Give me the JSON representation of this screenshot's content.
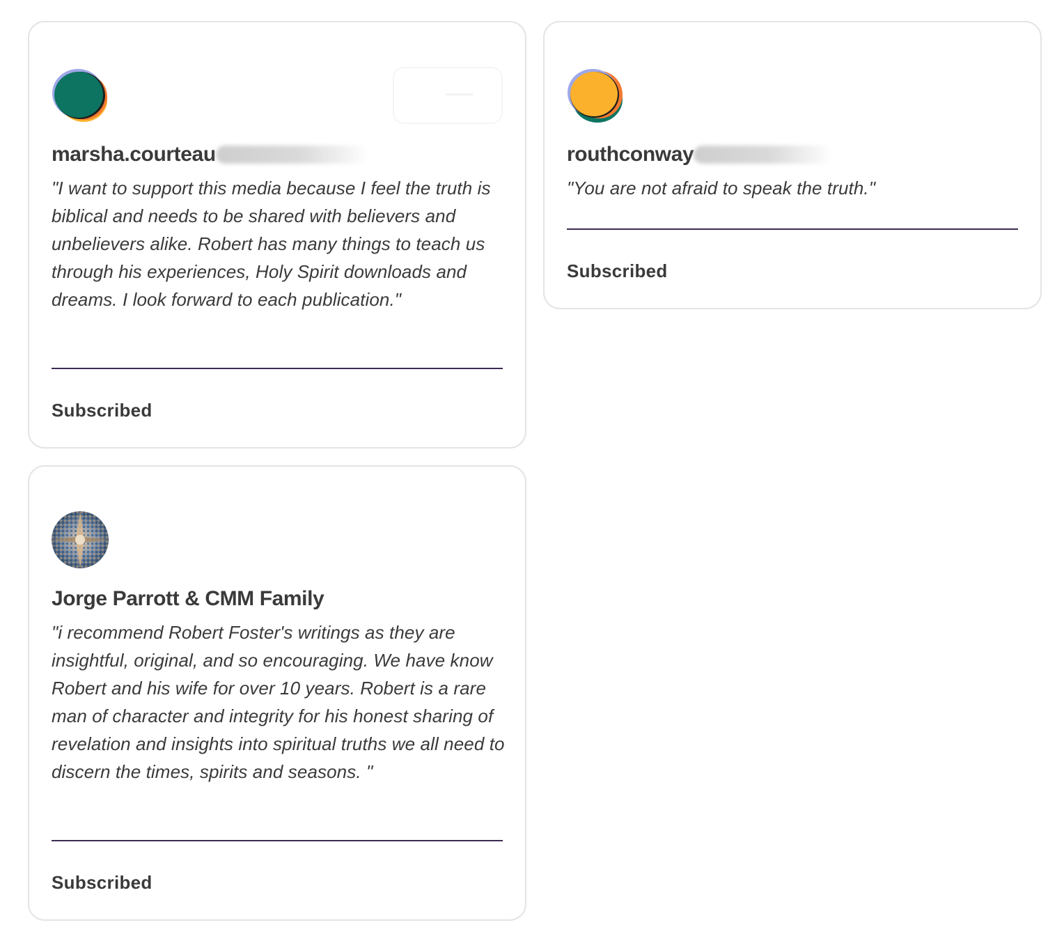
{
  "testimonials": [
    {
      "name": "marsha.courteau",
      "name_suffix_redacted": true,
      "quote": "\"I want to support this media because I feel the truth is biblical and needs to be shared with believers and unbelievers alike. Robert has many things to teach us through his experiences, Holy Spirit downloads and dreams. I look forward to each publication.\"",
      "status": "Subscribed",
      "avatar_icon": "green-orange-blob-avatar",
      "avatar_colors": [
        "#0c7461",
        "#f4792e",
        "#fbb12c",
        "#9fa8e8"
      ]
    },
    {
      "name": "routhconway",
      "name_suffix_redacted": true,
      "quote": "\"You are not afraid to speak the truth.\"",
      "status": "Subscribed",
      "avatar_icon": "yellow-green-blob-avatar",
      "avatar_colors": [
        "#fbb12c",
        "#0c7461",
        "#f4792e",
        "#9fa8e8"
      ]
    },
    {
      "name": "Jorge Parrott & CMM Family",
      "name_suffix_redacted": false,
      "quote": "\"i recommend Robert Foster's writings as they are insightful, original, and so encouraging. We have know Robert and his wife for over 10 years. Robert is a rare man of character and integrity for his honest sharing of revelation and insights into spiritual truths we all need to discern the times, spirits and seasons. \"",
      "status": "Subscribed",
      "avatar_icon": "mirrored-architecture-photo-avatar",
      "avatar_colors": [
        "#6f8fb3",
        "#c9a27a",
        "#3c5a7c"
      ]
    }
  ],
  "colors": {
    "card_border": "#e4e4e4",
    "divider": "#3d2a54",
    "text": "#3a3a3a"
  }
}
